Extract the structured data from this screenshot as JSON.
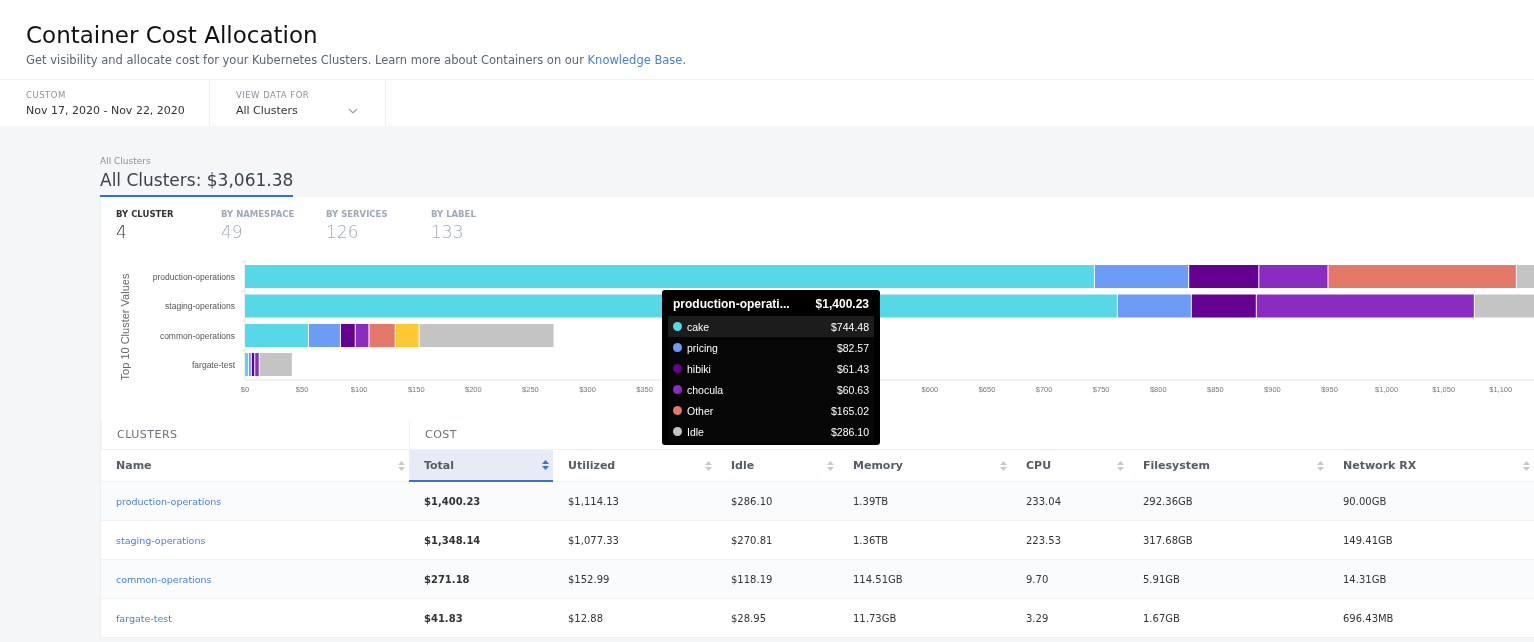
{
  "header": {
    "title": "Container Cost Allocation",
    "description": "Get visibility and allocate cost for your Kubernetes Clusters. Learn more about Containers on our ",
    "link": "Knowledge Base",
    "description_end": "."
  },
  "filters": [
    {
      "kind": "text",
      "label": "CUSTOM",
      "value": "Nov 17, 2020 - Nov 22, 2020"
    },
    {
      "kind": "dropdown",
      "label": "VIEW DATA FOR",
      "value": "All Clusters"
    }
  ],
  "summary": {
    "breadcrumb": "All Clusters",
    "title": "All Clusters: $3,061.38"
  },
  "breakdown_tabs": [
    {
      "label": "BY CLUSTER",
      "count": "4",
      "selected": true
    },
    {
      "label": "BY NAMESPACE",
      "count": "49",
      "selected": false
    },
    {
      "label": "BY SERVICES",
      "count": "126",
      "selected": false
    },
    {
      "label": "BY LABEL",
      "count": "133",
      "selected": false
    }
  ],
  "chart_data": {
    "type": "bar",
    "orientation": "horizontal",
    "stacked": true,
    "ylabel": "Top 10 Cluster Values",
    "categories": [
      "production-operations",
      "staging-operations",
      "common-operations",
      "fargate-test"
    ],
    "xlim": [
      0,
      1130
    ],
    "xticks": [
      {
        "value": 0,
        "label": "$0"
      },
      {
        "value": 50,
        "label": "$50"
      },
      {
        "value": 100,
        "label": "$100"
      },
      {
        "value": 150,
        "label": "$150"
      },
      {
        "value": 200,
        "label": "$200"
      },
      {
        "value": 250,
        "label": "$250"
      },
      {
        "value": 300,
        "label": "$300"
      },
      {
        "value": 350,
        "label": "$350"
      },
      {
        "value": 600,
        "label": "$600"
      },
      {
        "value": 650,
        "label": "$650"
      },
      {
        "value": 700,
        "label": "$700"
      },
      {
        "value": 750,
        "label": "$750"
      },
      {
        "value": 800,
        "label": "$800"
      },
      {
        "value": 850,
        "label": "$850"
      },
      {
        "value": 900,
        "label": "$900"
      },
      {
        "value": 950,
        "label": "$950"
      },
      {
        "value": 1000,
        "label": "$1,000"
      },
      {
        "value": 1050,
        "label": "$1,050"
      },
      {
        "value": 1100,
        "label": "$1,100"
      }
    ],
    "series": [
      {
        "color": "#56d8e6",
        "values": [
          744.5,
          764.6,
          56,
          3.5
        ]
      },
      {
        "color": "#6d9cf7",
        "values": [
          82.6,
          64.8,
          28,
          2.5
        ]
      },
      {
        "color": "#650090",
        "values": [
          61.4,
          56.9,
          13,
          3
        ]
      },
      {
        "color": "#8a2cbf",
        "values": [
          60.6,
          191,
          12,
          3.9
        ]
      },
      {
        "color": "#e47868",
        "values": [
          165,
          null,
          23,
          null
        ]
      },
      {
        "color": "#fcc932",
        "values": [
          null,
          null,
          21,
          null
        ]
      },
      {
        "color": "#c4c4c4",
        "values": [
          15.9,
          52.7,
          118.2,
          29
        ]
      }
    ]
  },
  "tooltip": {
    "title": "production-operati...",
    "total": "$1,400.23",
    "items": [
      {
        "name": "cake",
        "value": "$744.48",
        "color": "#56d8e6",
        "selected": true
      },
      {
        "name": "pricing",
        "value": "$82.57",
        "color": "#6d9cf7",
        "selected": false
      },
      {
        "name": "hibiki",
        "value": "$61.43",
        "color": "#650090",
        "selected": false
      },
      {
        "name": "chocula",
        "value": "$60.63",
        "color": "#8a2cbf",
        "selected": false
      },
      {
        "name": "Other",
        "value": "$165.02",
        "color": "#e47868",
        "selected": false
      },
      {
        "name": "Idle",
        "value": "$286.10",
        "color": "#c4c4c4",
        "selected": false
      }
    ]
  },
  "table": {
    "groups": [
      {
        "label": "CLUSTERS"
      },
      {
        "label": "COST"
      }
    ],
    "columns": [
      {
        "label": "Name",
        "kind": "link",
        "sorted": false
      },
      {
        "label": "Total",
        "kind": "bold",
        "sorted": true
      },
      {
        "label": "Utilized",
        "kind": "text",
        "sorted": false
      },
      {
        "label": "Idle",
        "kind": "text",
        "sorted": false
      },
      {
        "label": "Memory",
        "kind": "text",
        "sorted": false
      },
      {
        "label": "CPU",
        "kind": "text",
        "sorted": false
      },
      {
        "label": "Filesystem",
        "kind": "text",
        "sorted": false
      },
      {
        "label": "Network RX",
        "kind": "text",
        "sorted": false
      }
    ],
    "rows": [
      {
        "cells": [
          "production-operations",
          "$1,400.23",
          "$1,114.13",
          "$286.10",
          "1.39TB",
          "233.04",
          "292.36GB",
          "90.00GB"
        ]
      },
      {
        "cells": [
          "staging-operations",
          "$1,348.14",
          "$1,077.33",
          "$270.81",
          "1.36TB",
          "223.53",
          "317.68GB",
          "149.41GB"
        ]
      },
      {
        "cells": [
          "common-operations",
          "$271.18",
          "$152.99",
          "$118.19",
          "114.51GB",
          "9.70",
          "5.91GB",
          "14.31GB"
        ]
      },
      {
        "cells": [
          "fargate-test",
          "$41.83",
          "$12.88",
          "$28.95",
          "11.73GB",
          "3.29",
          "1.67GB",
          "696.43MB"
        ]
      }
    ]
  }
}
